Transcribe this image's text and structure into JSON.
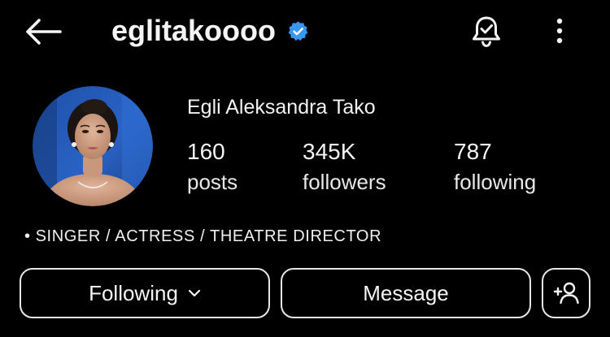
{
  "header": {
    "username": "eglitakoooo",
    "back_icon": "arrow-left-icon",
    "verified_icon": "verified-badge-icon",
    "notification_icon": "bell-check-icon",
    "more_icon": "vertical-dots-icon"
  },
  "profile": {
    "full_name": "Egli Aleksandra Tako",
    "avatar": "profile-photo",
    "stats": {
      "posts": {
        "value": "160",
        "label": "posts"
      },
      "followers": {
        "value": "345K",
        "label": "followers"
      },
      "following": {
        "value": "787",
        "label": "following"
      }
    },
    "bio_bullet": "•",
    "bio": "SINGER / ACTRESS / THEATRE DIRECTOR"
  },
  "actions": {
    "following_label": "Following",
    "message_label": "Message",
    "add_user_icon": "add-person-icon"
  },
  "colors": {
    "background": "#000000",
    "text": "#f5f5f5",
    "verified": "#3897f0",
    "button_border": "#e6e6e6"
  }
}
